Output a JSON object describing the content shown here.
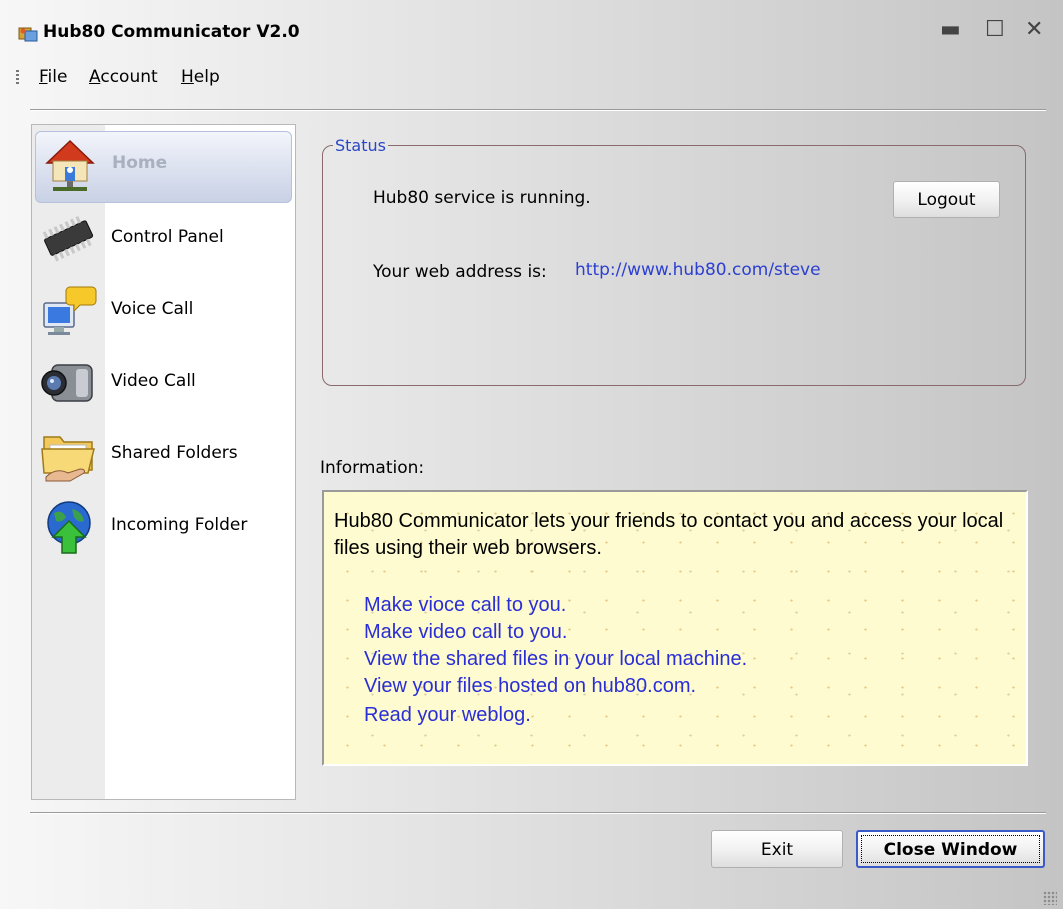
{
  "window": {
    "title": "Hub80 Communicator V2.0"
  },
  "window_controls": {
    "minimize": "▬",
    "maximize": "☐",
    "close": "✕"
  },
  "menu": [
    {
      "label": "File",
      "accel": "F",
      "rest": "ile"
    },
    {
      "label": "Account",
      "accel": "A",
      "rest": "ccount"
    },
    {
      "label": "Help",
      "accel": "H",
      "rest": "elp"
    }
  ],
  "sidebar": {
    "items": [
      {
        "label": "Home",
        "icon": "home-icon",
        "active": true
      },
      {
        "label": "Control Panel",
        "icon": "chip-icon"
      },
      {
        "label": "Voice Call",
        "icon": "computer-chat-icon"
      },
      {
        "label": "Video Call",
        "icon": "video-camera-icon"
      },
      {
        "label": "Shared Folders",
        "icon": "shared-folder-icon"
      },
      {
        "label": "Incoming Folder",
        "icon": "globe-download-icon"
      }
    ]
  },
  "status": {
    "legend": "Status",
    "service_text": "Hub80 service is running.",
    "logout_label": "Logout",
    "address_label": "Your web address is:",
    "address_url": "http://www.hub80.com/steve"
  },
  "information": {
    "label": "Information:",
    "intro": "Hub80 Communicator lets your friends to contact you and access your local files using their web browsers.",
    "links": [
      "Make vioce call to you.",
      "Make video call to you.",
      "View the shared files in your local machine.",
      "View your files hosted on hub80.com.",
      "Read your weblog."
    ]
  },
  "footer": {
    "exit_label": "Exit",
    "close_label": "Close Window"
  },
  "colors": {
    "link": "#2b3fd1",
    "info_background": "#fdfbcf",
    "legend": "#2946c8"
  }
}
